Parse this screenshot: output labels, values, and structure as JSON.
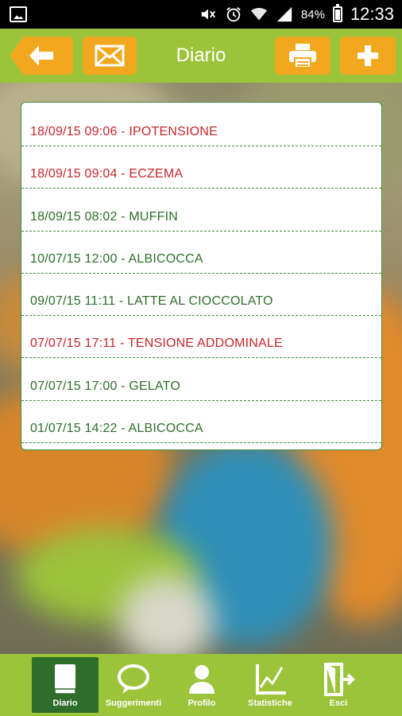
{
  "status_bar": {
    "battery": "84%",
    "time": "12:33",
    "icons": [
      "gallery-icon",
      "mute-icon",
      "alarm-icon",
      "wifi-icon",
      "signal-icon",
      "battery-icon"
    ]
  },
  "header": {
    "title": "Diario",
    "buttons": [
      "back-arrow-icon",
      "mail-icon",
      "print-icon",
      "plus-icon"
    ]
  },
  "diary": {
    "entries": [
      {
        "text": "18/09/15 09:06 - IPOTENSIONE",
        "color": "red"
      },
      {
        "text": "18/09/15 09:04 - ECZEMA",
        "color": "red"
      },
      {
        "text": "18/09/15 08:02 - MUFFIN",
        "color": "green"
      },
      {
        "text": "10/07/15 12:00 - ALBICOCCA",
        "color": "green"
      },
      {
        "text": "09/07/15 11:11 - LATTE AL CIOCCOLATO",
        "color": "green"
      },
      {
        "text": "07/07/15 17:11 - TENSIONE ADDOMINALE",
        "color": "red"
      },
      {
        "text": "07/07/15 17:00 - GELATO",
        "color": "green"
      },
      {
        "text": "01/07/15 14:22 - ALBICOCCA",
        "color": "green"
      }
    ]
  },
  "nav": {
    "items": [
      {
        "label": "Diario",
        "icon": "book-icon",
        "active": true
      },
      {
        "label": "Suggerimenti",
        "icon": "speech-bubble-icon",
        "active": false
      },
      {
        "label": "Profilo",
        "icon": "person-icon",
        "active": false
      },
      {
        "label": "Statistiche",
        "icon": "chart-icon",
        "active": false
      },
      {
        "label": "Esci",
        "icon": "exit-door-icon",
        "active": false
      }
    ]
  },
  "colors": {
    "header_green": "#9bc43a",
    "button_orange": "#f2a81e",
    "dark_green": "#2e6e2a",
    "alert_red": "#c8252b"
  }
}
